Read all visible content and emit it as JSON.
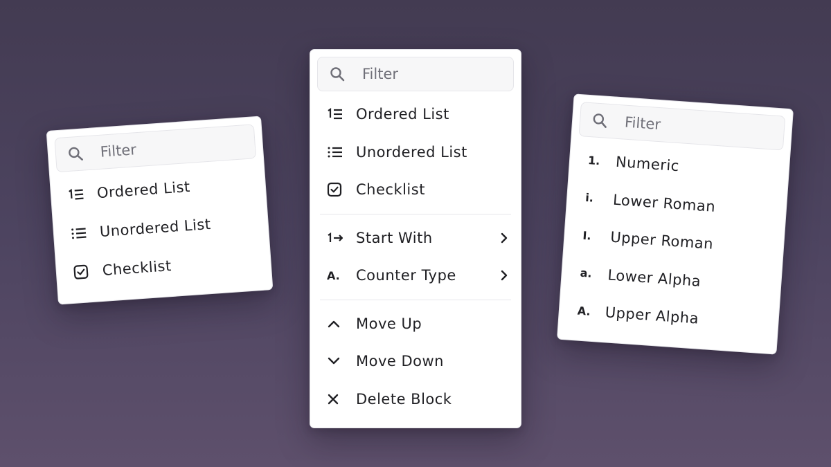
{
  "left_menu": {
    "filter_placeholder": "Filter",
    "items": [
      {
        "label": "Ordered List",
        "icon": "ordered-list-icon"
      },
      {
        "label": "Unordered List",
        "icon": "unordered-list-icon"
      },
      {
        "label": "Checklist",
        "icon": "checklist-icon"
      }
    ]
  },
  "main_menu": {
    "filter_placeholder": "Filter",
    "list_types": [
      {
        "label": "Ordered List",
        "icon": "ordered-list-icon"
      },
      {
        "label": "Unordered List",
        "icon": "unordered-list-icon"
      },
      {
        "label": "Checklist",
        "icon": "checklist-icon"
      }
    ],
    "options": [
      {
        "label": "Start With",
        "icon": "start-with-icon",
        "submenu": true
      },
      {
        "label": "Counter Type",
        "icon": "counter-type-icon",
        "icon_text": "A.",
        "submenu": true
      }
    ],
    "actions": [
      {
        "label": "Move Up",
        "icon": "chevron-up-icon"
      },
      {
        "label": "Move Down",
        "icon": "chevron-down-icon"
      },
      {
        "label": "Delete Block",
        "icon": "close-icon"
      }
    ]
  },
  "right_menu": {
    "filter_placeholder": "Filter",
    "items": [
      {
        "marker": "1.",
        "label": "Numeric"
      },
      {
        "marker": "i.",
        "label": "Lower Roman"
      },
      {
        "marker": "I.",
        "label": "Upper Roman"
      },
      {
        "marker": "a.",
        "label": "Lower Alpha"
      },
      {
        "marker": "A.",
        "label": "Upper Alpha"
      }
    ]
  },
  "colors": {
    "background_top": "#433b52",
    "background_bottom": "#5e506c",
    "menu_bg": "#ffffff",
    "filter_bg": "#f7f7f8",
    "text": "#1f1f23",
    "placeholder": "#6f6f78"
  }
}
